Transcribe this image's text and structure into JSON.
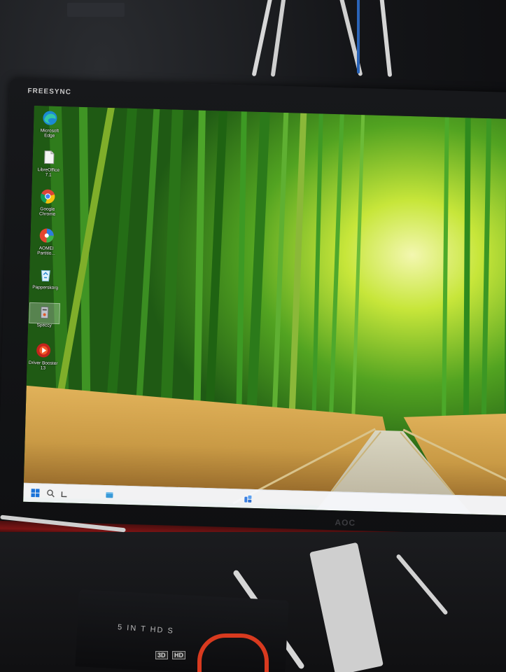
{
  "monitor": {
    "brand_top": "FREESYNC",
    "brand_bottom": "AOC"
  },
  "desktop_icons": [
    {
      "label": "Microsoft Edge",
      "icon": "edge-icon"
    },
    {
      "label": "LibreOffice 7.1",
      "icon": "libreoffice-icon"
    },
    {
      "label": "Google Chrome",
      "icon": "chrome-icon"
    },
    {
      "label": "AOMEI Partitio...",
      "icon": "aomei-icon"
    },
    {
      "label": "Papperskorg",
      "icon": "recycle-bin-icon"
    },
    {
      "label": "Speccy",
      "icon": "speccy-icon"
    },
    {
      "label": "Driver Booster 13",
      "icon": "driver-booster-icon"
    }
  ],
  "taskbar": {
    "items": [
      "start-icon",
      "search-icon",
      "task-view-icon",
      "file-explorer-icon",
      "widgets-icon"
    ]
  },
  "switch_box": {
    "label": "5 IN    T HD   S",
    "badges": [
      "3D",
      "HD"
    ]
  },
  "colors": {
    "bezel_red": "#7b1414",
    "taskbar": "#f6f8fc",
    "bamboo_light": "#c7e63a",
    "bamboo_dark": "#1f5a14",
    "grass": "#c99a45"
  }
}
